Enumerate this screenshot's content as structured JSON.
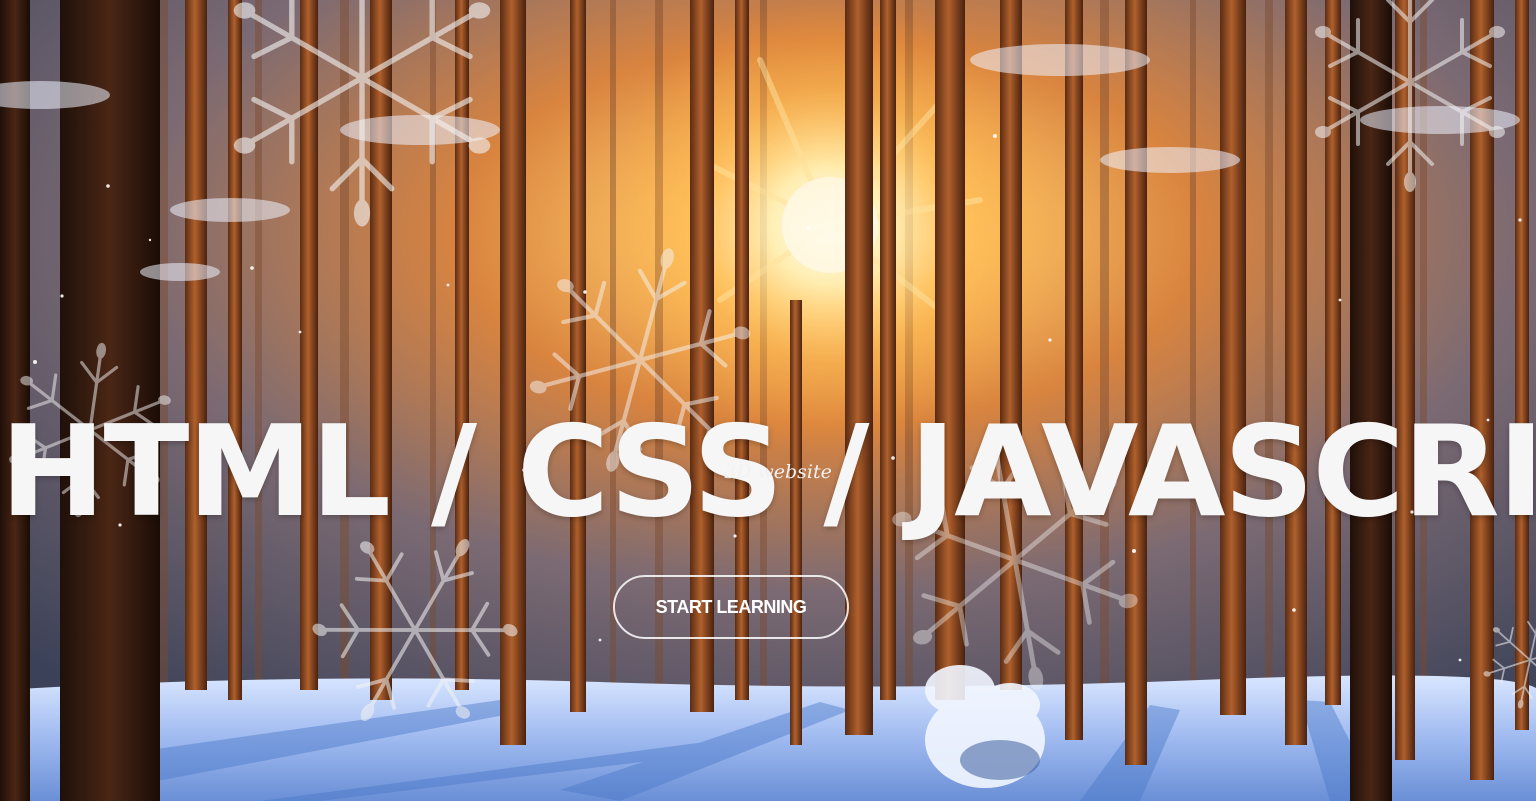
{
  "hero": {
    "title": "HTML / CSS / JAVASCRIPT",
    "subtitle": "3D website",
    "cta_label": "START LEARNING"
  },
  "colors": {
    "sky_glow": "#ffb347",
    "sun_core": "#fff6d0",
    "trunk_dark": "#3a1e10",
    "trunk_warm": "#8a4a22",
    "snow": "#e8f0ff",
    "snow_shadow": "#4a78c8",
    "text": "#f6f6f6"
  },
  "icons": {
    "snowflake": "snowflake-icon"
  }
}
